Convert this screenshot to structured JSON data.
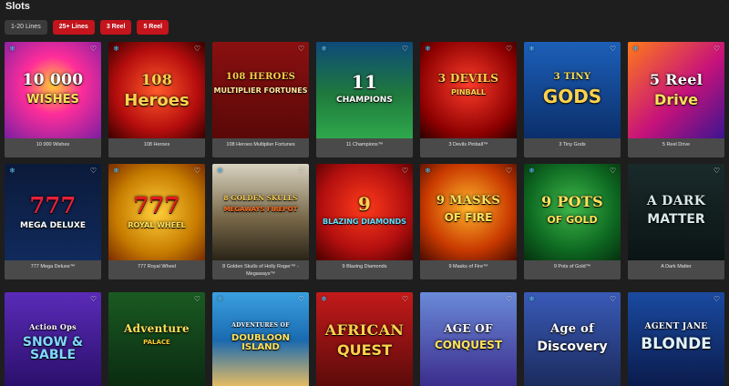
{
  "section_title": "Slots",
  "filters": [
    "1-20 Lines",
    "25+ Lines",
    "3 Reel",
    "5 Reel"
  ],
  "colors": {
    "accent": "#c4141c",
    "background": "#1e1e1e",
    "caption_bg": "#4a4a4a"
  },
  "games": [
    {
      "name": "10 000 Wishes",
      "logo": [
        "10 000",
        "WISHES"
      ]
    },
    {
      "name": "108 Heroes",
      "logo": [
        "108",
        "Heroes"
      ]
    },
    {
      "name": "108 Heroes Multiplier Fortunes",
      "logo": [
        "108 HEROES",
        "MULTIPLIER FORTUNES"
      ]
    },
    {
      "name": "11 Champions™",
      "logo": [
        "11",
        "CHAMPIONS"
      ]
    },
    {
      "name": "3 Devils Pinball™",
      "logo": [
        "3 DEVILS",
        "PINBALL"
      ]
    },
    {
      "name": "3 Tiny Gods",
      "logo": [
        "3 TINY",
        "GODS"
      ]
    },
    {
      "name": "5 Reel Drive",
      "logo": [
        "5 Reel",
        "Drive"
      ]
    },
    {
      "name": "777 Mega Deluxe™",
      "logo": [
        "777",
        "MEGA DELUXE"
      ]
    },
    {
      "name": "777 Royal Wheel",
      "logo": [
        "777",
        "ROYAL WHEEL"
      ]
    },
    {
      "name": "8 Golden Skulls of Holly Roger™ - Megaways™",
      "logo": [
        "8 GOLDEN SKULLS",
        "MEGAWAYS FIREPOT"
      ]
    },
    {
      "name": "9 Blazing Diamonds",
      "logo": [
        "9",
        "BLAZING DIAMONDS"
      ]
    },
    {
      "name": "9 Masks of Fire™",
      "logo": [
        "9 MASKS",
        "OF FIRE"
      ]
    },
    {
      "name": "9 Pots of Gold™",
      "logo": [
        "9 POTS",
        "OF GOLD"
      ]
    },
    {
      "name": "A Dark Matter",
      "logo": [
        "A DARK",
        "MATTER"
      ]
    },
    {
      "name": "",
      "logo": [
        "Action Ops",
        "SNOW & SABLE"
      ]
    },
    {
      "name": "",
      "logo": [
        "Adventure",
        "PALACE"
      ]
    },
    {
      "name": "",
      "logo": [
        "ADVENTURES OF",
        "DOUBLOON ISLAND"
      ]
    },
    {
      "name": "",
      "logo": [
        "AFRICAN",
        "QUEST"
      ]
    },
    {
      "name": "",
      "logo": [
        "AGE OF",
        "CONQUEST"
      ]
    },
    {
      "name": "",
      "logo": [
        "Age of",
        "Discovery"
      ]
    },
    {
      "name": "",
      "logo": [
        "AGENT JANE",
        "BLONDE"
      ]
    }
  ]
}
